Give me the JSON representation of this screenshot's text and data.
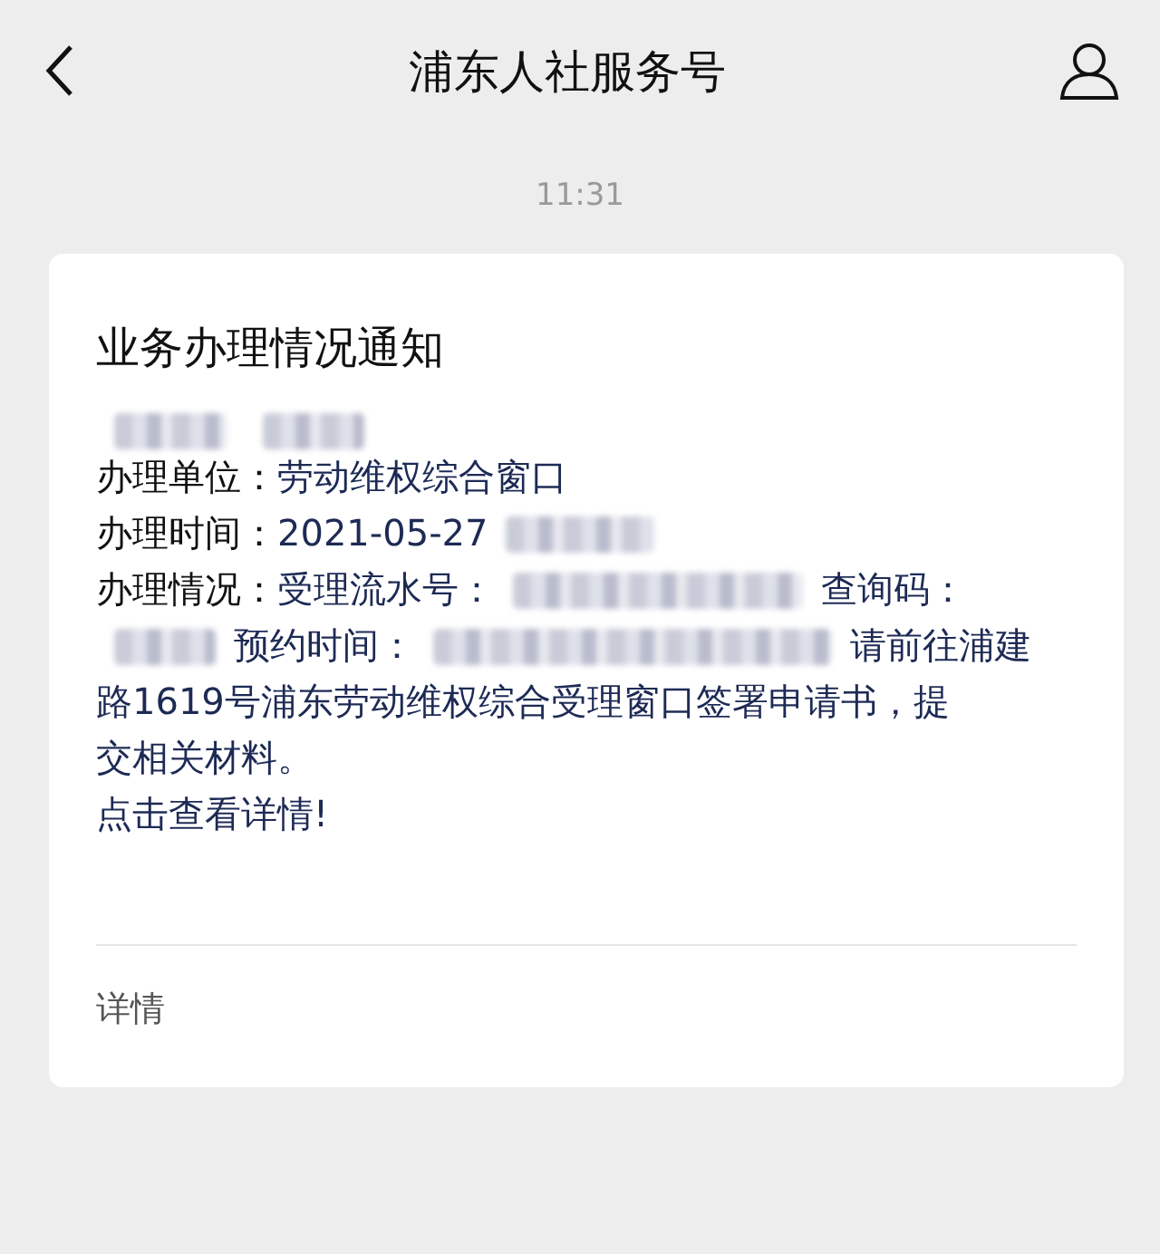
{
  "header": {
    "title": "浦东人社服务号"
  },
  "timestamp": "11:31",
  "card": {
    "title": "业务办理情况通知",
    "lines": [
      [
        {
          "kind": "blur"
        },
        {
          "kind": "blur"
        }
      ],
      [
        {
          "kind": "label",
          "text": "办理单位："
        },
        {
          "kind": "value",
          "text": "劳动维权综合窗口"
        }
      ],
      [
        {
          "kind": "label",
          "text": "办理时间："
        },
        {
          "kind": "value",
          "text": "2021-05-27"
        },
        {
          "kind": "blur"
        }
      ],
      [
        {
          "kind": "label",
          "text": "办理情况："
        },
        {
          "kind": "value",
          "text": "受理流水号："
        },
        {
          "kind": "blur"
        },
        {
          "kind": "value",
          "text": "查询码："
        }
      ],
      [
        {
          "kind": "blur"
        },
        {
          "kind": "value",
          "text": "预约时间："
        },
        {
          "kind": "blur"
        },
        {
          "kind": "value",
          "text": "请前往浦建"
        }
      ],
      [
        {
          "kind": "value",
          "text": "路1619号浦东劳动维权综合受理窗口签署申请书，提"
        }
      ],
      [
        {
          "kind": "value",
          "text": "交相关材料。"
        }
      ],
      [
        {
          "kind": "value",
          "text": "点击查看详情!"
        }
      ]
    ],
    "footer": "详情"
  }
}
